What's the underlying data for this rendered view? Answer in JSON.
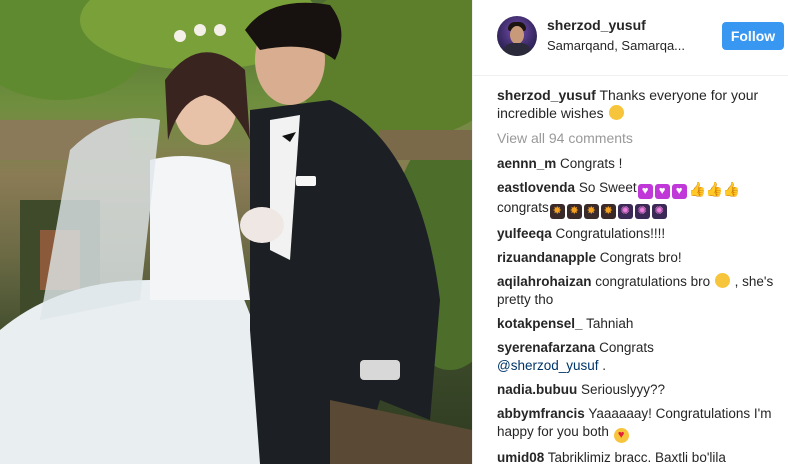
{
  "post": {
    "username": "sherzod_yusuf",
    "location": "Samarqand, Samarqa...",
    "follow_label": "Follow"
  },
  "caption": {
    "username": "sherzod_yusuf",
    "text": "Thanks everyone for your incredible wishes",
    "emoji": "smiling-face"
  },
  "view_all": "View all 94 comments",
  "comments": [
    {
      "user": "aennn_m",
      "text": "Congrats !"
    },
    {
      "user": "eastlovenda",
      "text": "So Sweet",
      "after": "congrats",
      "emojis": [
        "purple-heart",
        "purple-heart",
        "purple-heart",
        "thumbs-up",
        "thumbs-up",
        "thumbs-up"
      ],
      "emojis2": [
        "firework",
        "firework",
        "firework",
        "firework",
        "sparkle",
        "sparkle",
        "sparkle"
      ]
    },
    {
      "user": "yulfeeqa",
      "text": "Congratulations!!!!"
    },
    {
      "user": "rizuandanapple",
      "text": "Congrats bro!"
    },
    {
      "user": "aqilahrohaizan",
      "text": "congratulations bro",
      "tail": ", she's pretty tho",
      "emoji": "smiling-face"
    },
    {
      "user": "kotakpensel_",
      "text": "Tahniah"
    },
    {
      "user": "syerenafarzana",
      "text": "Congrats",
      "mention": "@sherzod_yusuf",
      "tail": "."
    },
    {
      "user": "nadia.bubuu",
      "text": "Seriouslyyy??"
    },
    {
      "user": "abbymfrancis",
      "text": "Yaaaaaay! Congratulations I'm happy for you both",
      "emoji": "heart-eyes"
    },
    {
      "user": "umid08",
      "text": "Tabriklimiz bracc. Baxtli bo'lila"
    }
  ]
}
